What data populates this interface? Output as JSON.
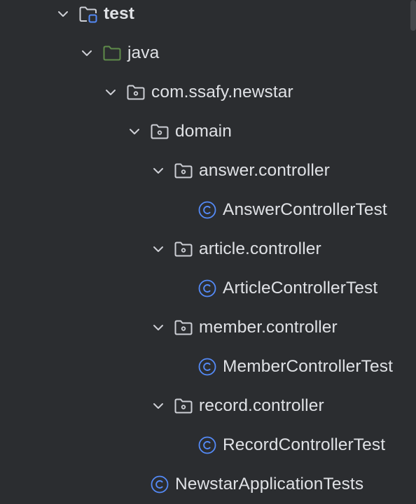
{
  "project_tree": {
    "items": [
      {
        "label": "test",
        "type": "test-root-folder",
        "expanded": true
      },
      {
        "label": "java",
        "type": "source-folder",
        "expanded": true
      },
      {
        "label": "com.ssafy.newstar",
        "type": "package",
        "expanded": true
      },
      {
        "label": "domain",
        "type": "package",
        "expanded": true
      },
      {
        "label": "answer.controller",
        "type": "package",
        "expanded": true
      },
      {
        "label": "AnswerControllerTest",
        "type": "class"
      },
      {
        "label": "article.controller",
        "type": "package",
        "expanded": true
      },
      {
        "label": "ArticleControllerTest",
        "type": "class"
      },
      {
        "label": "member.controller",
        "type": "package",
        "expanded": true
      },
      {
        "label": "MemberControllerTest",
        "type": "class"
      },
      {
        "label": "record.controller",
        "type": "package",
        "expanded": true
      },
      {
        "label": "RecordControllerTest",
        "type": "class"
      },
      {
        "label": "NewstarApplicationTests",
        "type": "class"
      }
    ]
  },
  "colors": {
    "background": "#2b2d30",
    "text": "#dfe1e5",
    "icon_gray": "#ced0d6",
    "source_folder_green": "#5f8c4a",
    "test_root_blue": "#548af7",
    "class_blue": "#548af7"
  }
}
